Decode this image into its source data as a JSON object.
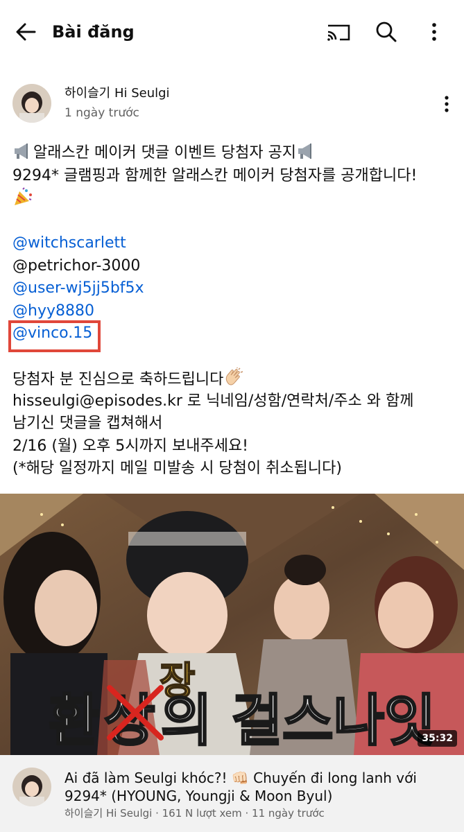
{
  "header": {
    "title": "Bài đăng",
    "icons": [
      "back-arrow-icon",
      "cast-icon",
      "search-icon",
      "more-vert-icon"
    ]
  },
  "post": {
    "channel": "하이슬기 Hi Seulgi",
    "time": "1 ngày trước",
    "lines": [
      "알래스칸 메이커 댓글 이벤트 당첨자 공지",
      "9294* 글램핑과 함께한 알래스칸 메이커 당첨자를 공개합니다!"
    ],
    "mentions": [
      "@witchscarlett",
      "@petrichor-3000",
      "@user-wj5jj5bf5x",
      "@hyy8880",
      "@vinco.15"
    ],
    "congrats": "당첨자 분 진심으로 축하드립니다",
    "instructions": [
      "hisseulgi@episodes.kr 로 닉네임/성함/연락처/주소 와 함께",
      "남기신 댓글을 캡쳐해서",
      "2/16 (월) 오후 5시까지 보내주세요!",
      "(*해당 일정까지 메일 미발송 시 당첨이 취소됩니다)"
    ]
  },
  "thumbnail": {
    "duration": "35:32",
    "overlay_top": "장",
    "overlay_main": [
      "환",
      "상",
      "의 걸스나잇"
    ]
  },
  "video": {
    "title": "Ai đã làm Seulgi khóc?! 👊🏻 Chuyến đi long lanh với 9294* (HYOUNG, Youngji & Moon Byul)",
    "meta": "하이슬기 Hi Seulgi · 161 N lượt xem · 11 ngày trước"
  },
  "colors": {
    "link": "#065fd4",
    "highlight_box": "#e0473a",
    "secondary_text": "#606060"
  }
}
